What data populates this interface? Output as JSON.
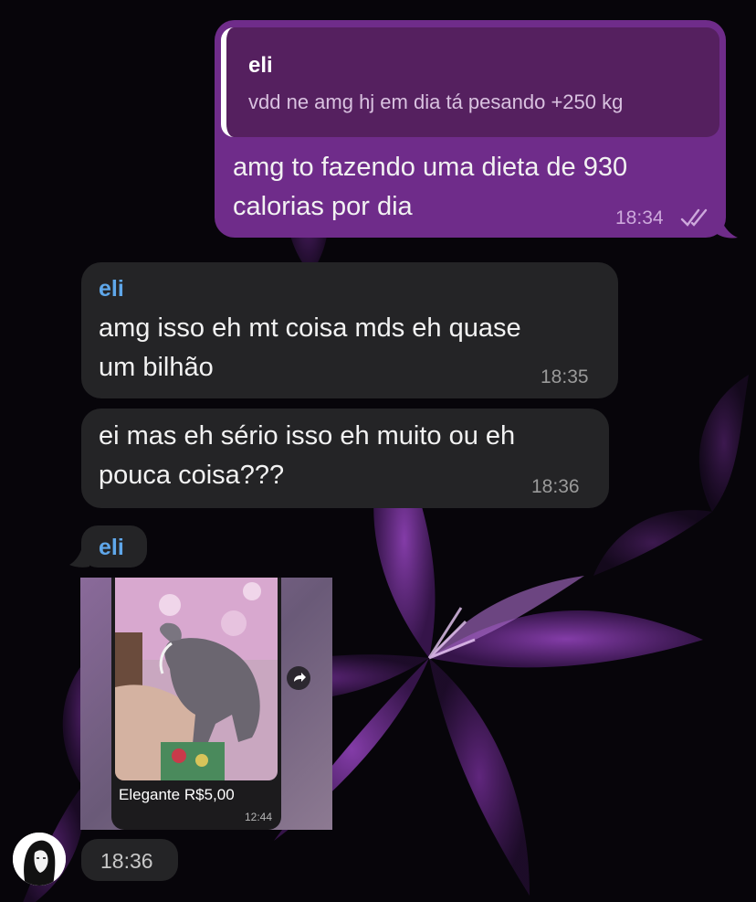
{
  "chat": {
    "outgoing": {
      "reply_to_name": "eli",
      "reply_to_text": "vdd ne amg hj em dia tá pesando +250 kg",
      "line1": "amg to fazendo uma dieta de 930",
      "line2": "calorias por dia",
      "time": "18:34",
      "status_icon": "double-check-icon"
    },
    "incoming": [
      {
        "sender": "eli",
        "line1": "amg isso eh mt coisa mds eh quase",
        "line2": "um bilhão",
        "time": "18:35"
      },
      {
        "line1": "ei mas eh sério isso eh muito ou eh",
        "line2": "pouca coisa???",
        "time": "18:36"
      }
    ],
    "media_message": {
      "sender": "eli",
      "caption": "Elegante R$5,00",
      "inner_time": "12:44",
      "time": "18:36",
      "share_icon": "forward-icon"
    },
    "avatar_icon": "user-avatar-icon"
  },
  "colors": {
    "outgoing_bubble": "#6f2c8a",
    "incoming_bubble": "#242426",
    "sender_name": "#5fa7ea",
    "background": "#07050a"
  }
}
